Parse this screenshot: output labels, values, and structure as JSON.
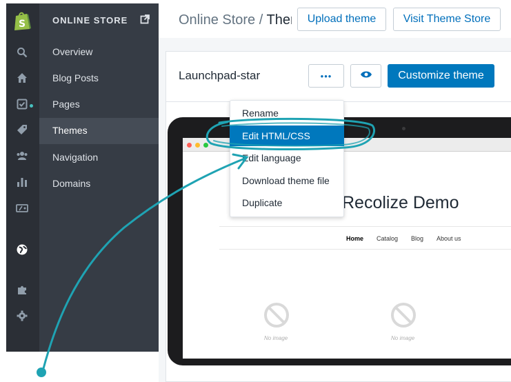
{
  "sidebar": {
    "icons": [
      "shopify-logo",
      "search-icon",
      "home-icon",
      "orders-icon",
      "tag-icon",
      "customers-icon",
      "analytics-icon",
      "discounts-icon",
      "globe-icon",
      "apps-icon",
      "settings-icon"
    ],
    "section_title": "ONLINE STORE",
    "items": [
      {
        "label": "Overview"
      },
      {
        "label": "Blog Posts"
      },
      {
        "label": "Pages"
      },
      {
        "label": "Themes"
      },
      {
        "label": "Navigation"
      },
      {
        "label": "Domains"
      }
    ],
    "active_item": "Themes"
  },
  "header": {
    "breadcrumb_parent": "Online Store",
    "breadcrumb_separator": " / ",
    "breadcrumb_current": "Themes",
    "upload_label": "Upload theme",
    "visit_label": "Visit Theme Store"
  },
  "theme_card": {
    "name": "Launchpad-star",
    "more_label": "•••",
    "customize_label": "Customize theme"
  },
  "menu": {
    "items": [
      {
        "label": "Rename"
      },
      {
        "label": "Edit HTML/CSS"
      },
      {
        "label": "Edit language"
      },
      {
        "label": "Download theme file"
      },
      {
        "label": "Duplicate"
      }
    ],
    "highlighted": "Edit HTML/CSS"
  },
  "preview": {
    "store_title": "Recolize Demo",
    "nav": [
      "Home",
      "Catalog",
      "Blog",
      "About us"
    ],
    "no_image_label": "No image"
  },
  "colors": {
    "rail": "#2b2f36",
    "subnav": "#363c45",
    "primary": "#0078bd",
    "annotation": "#1fa3b3"
  }
}
